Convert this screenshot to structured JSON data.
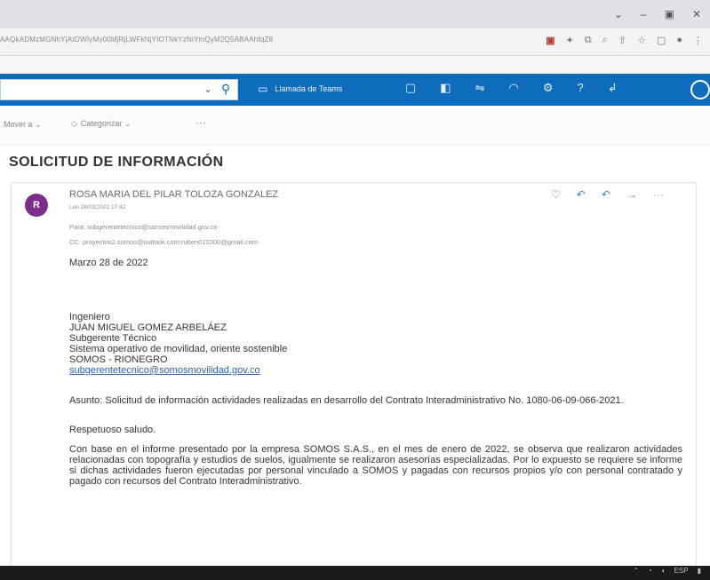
{
  "window": {
    "controls": [
      "⌄",
      "–",
      "▣",
      "✕"
    ]
  },
  "browser": {
    "url": "AAQkADMzMGNhYjAtOWIyMy00MjRjLWFkNjYtOTNkYzNiYmQyM2Q5ABAAhfqZ8",
    "extension_icons": [
      "▣",
      "✦",
      "⧉",
      "⌕",
      "⇧",
      "☆",
      "▢",
      "●",
      "⋮"
    ]
  },
  "outlook": {
    "search": {
      "placeholder": "",
      "value": ""
    },
    "teams_label": "Llamada de Teams",
    "icons": [
      "teams-call",
      "chat",
      "outlook-app",
      "calendar",
      "bell",
      "settings",
      "help",
      "feedback"
    ],
    "accent": "#0f6cbd"
  },
  "toolbar": {
    "move_label": "Mover a ⌄",
    "categorize_label": "Categorizar ⌄",
    "more_label": "···"
  },
  "email": {
    "subject": "SOLICITUD DE INFORMACIÓN",
    "avatar_initial": "R",
    "sender": "ROSA MARIA DEL PILAR TOLOZA GONZALEZ",
    "date": "Lun 28/03/2022 17:42",
    "to": "Para: subgerentetecnico@somosmovilidad.gov.co",
    "cc": "CC: proyectos2.somos@outlook.com;ruben010300@gmail.com",
    "date_line": "Marzo 28 de 2022",
    "recipient_lines": [
      "Ingeniero",
      "JUAN MIGUEL GOMEZ ARBELÁEZ",
      "Subgerente Técnico",
      "Sistema operativo de movilidad, oriente sostenible",
      "SOMOS - RIONEGRO"
    ],
    "recipient_email": "subgerentetecnico@somosmovilidad.gov.co",
    "asunto": "Asunto:    Solicitud de información actividades realizadas en desarrollo del Contrato Interadministrativo No. 1080-06-09-066-2021.",
    "greeting": "Respetuoso saludo.",
    "paragraph": "Con base en el informe presentado por la empresa SOMOS S.A.S., en el mes de enero de 2022, se observa que realizaron actividades relacionadas con topografía y estudios de suelos, igualmente se realizaron asesorías especializadas. Por lo expuesto se requiere se informe si dichas actividades fueron ejecutadas por personal vinculado a SOMOS y pagadas con recursos propios y/o con personal contratado y pagado con recursos del Contrato Interadministrativo."
  },
  "taskbar": {
    "tray_label": "ESP"
  }
}
